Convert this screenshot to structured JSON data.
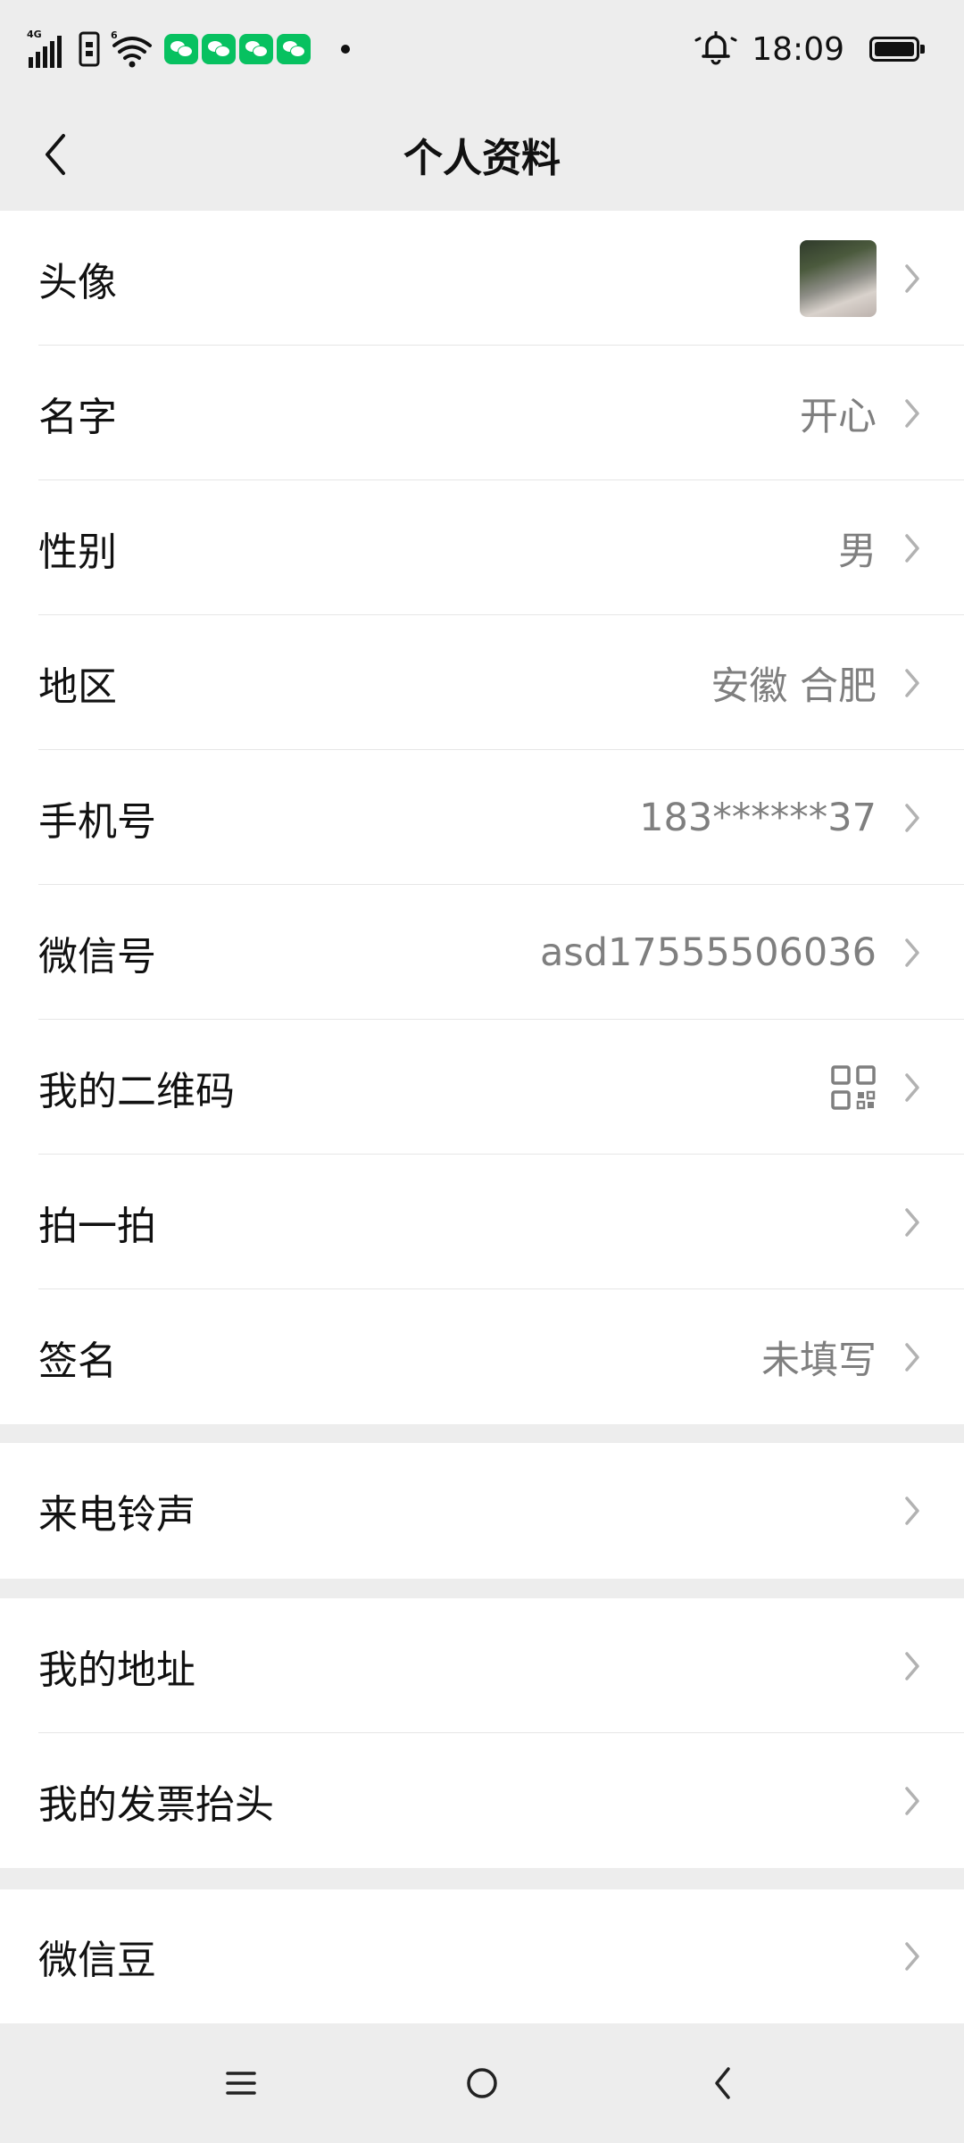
{
  "status_bar": {
    "network_label": "4G",
    "wifi_label": "6",
    "time": "18:09"
  },
  "nav": {
    "title": "个人资料"
  },
  "profile_group": [
    {
      "label": "头像",
      "value": ""
    },
    {
      "label": "名字",
      "value": "开心"
    },
    {
      "label": "性别",
      "value": "男"
    },
    {
      "label": "地区",
      "value": "安徽 合肥"
    },
    {
      "label": "手机号",
      "value": "183******37"
    },
    {
      "label": "微信号",
      "value": "asd17555506036"
    },
    {
      "label": "我的二维码",
      "value": ""
    },
    {
      "label": "拍一拍",
      "value": ""
    },
    {
      "label": "签名",
      "value": "未填写"
    }
  ],
  "ringtone_group": [
    {
      "label": "来电铃声",
      "value": ""
    }
  ],
  "address_group": [
    {
      "label": "我的地址",
      "value": ""
    },
    {
      "label": "我的发票抬头",
      "value": ""
    }
  ],
  "beans_group": [
    {
      "label": "微信豆",
      "value": ""
    }
  ],
  "icons": {
    "back": "chevron-left-icon",
    "row_arrow": "chevron-right-icon",
    "qr": "qr-code-icon",
    "alarm": "bell-icon",
    "battery": "battery-icon"
  },
  "colors": {
    "background": "#ededed",
    "card": "#ffffff",
    "secondary_text": "#7f7f7f",
    "wechat_green": "#07c160"
  }
}
